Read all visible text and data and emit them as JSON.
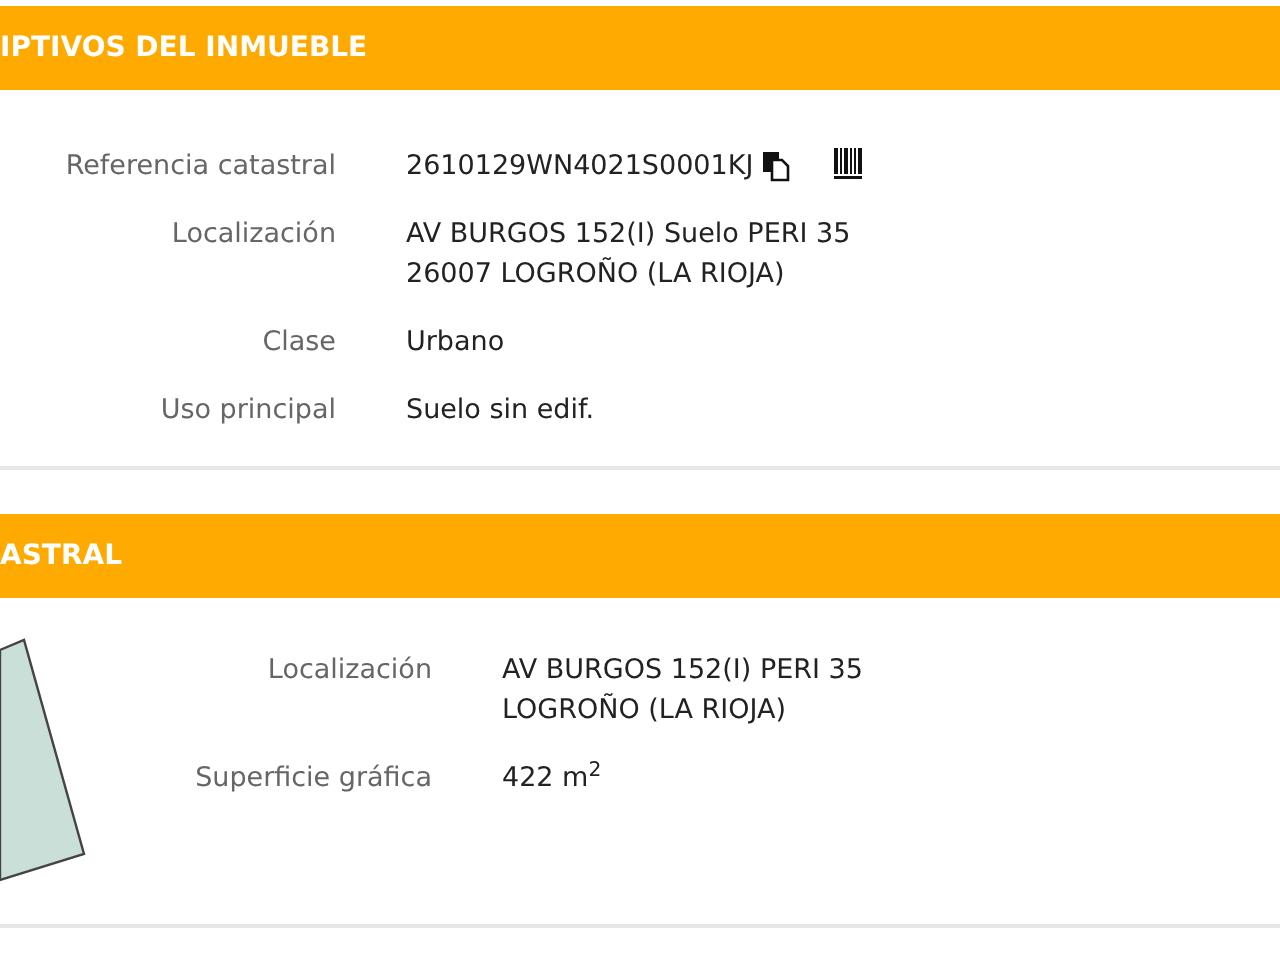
{
  "sections": [
    {
      "title": "IPTIVOS DEL INMUEBLE",
      "has_parcel": false,
      "rows": [
        {
          "label": "Referencia catastral",
          "lines": [
            "2610129WN4021S0001KJ"
          ],
          "icons": true
        },
        {
          "label": "Localización",
          "lines": [
            "AV BURGOS 152(I) Suelo PERI 35",
            "26007 LOGROÑO (LA RIOJA)"
          ],
          "icons": false
        },
        {
          "label": "Clase",
          "lines": [
            "Urbano"
          ],
          "icons": false
        },
        {
          "label": "Uso principal",
          "lines": [
            "Suelo sin edif."
          ],
          "icons": false
        }
      ]
    },
    {
      "title": "ASTRAL",
      "has_parcel": true,
      "rows": [
        {
          "label": "Localización",
          "lines": [
            "AV BURGOS 152(I) PERI 35",
            "LOGROÑO (LA RIOJA)"
          ],
          "icons": false
        },
        {
          "label": "Superficie gráfica",
          "lines": [
            "422 m$^{2}$"
          ],
          "icons": false
        }
      ]
    }
  ]
}
